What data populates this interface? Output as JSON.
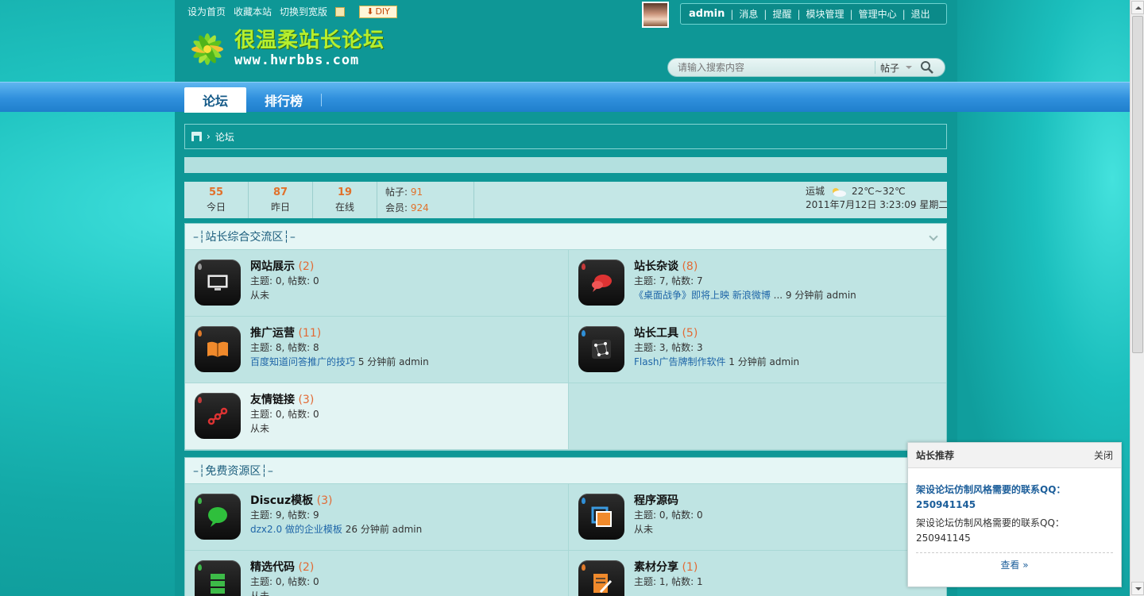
{
  "top_links": [
    "设为首页",
    "收藏本站",
    "切换到宽版"
  ],
  "diy_label": "DIY",
  "logo": {
    "title": "很温柔站长论坛",
    "url": "www.hwrbbs.com"
  },
  "user_bar": {
    "username": "admin",
    "items": [
      "消息",
      "提醒",
      "模块管理",
      "管理中心",
      "退出"
    ]
  },
  "search": {
    "placeholder": "请输入搜索内容",
    "type": "帖子"
  },
  "nav": {
    "tabs": [
      "论坛",
      "排行榜"
    ]
  },
  "breadcrumb": {
    "current": "论坛"
  },
  "stats": {
    "today": {
      "value": "55",
      "label": "今日"
    },
    "yesterday": {
      "value": "87",
      "label": "昨日"
    },
    "online": {
      "value": "19",
      "label": "在线"
    },
    "posts_label": "帖子: ",
    "posts": "91",
    "members_label": "会员: ",
    "members": "924",
    "weather_city": "运城",
    "weather_temp": "22℃~32℃",
    "datetime": "2011年7月12日 3:23:09 星期二"
  },
  "sections": [
    {
      "title": "–┆站长综合交流区┆–",
      "forums": [
        {
          "name": "网站展示",
          "count": "(2)",
          "meta": "主题: 0, 帖数: 0",
          "last": "从未",
          "last_link": "",
          "icon": "monitor-icon",
          "drop": "#9a9a9a"
        },
        {
          "name": "站长杂谈",
          "count": "(8)",
          "meta": "主题: 7, 帖数: 7",
          "last": " ... 9 分钟前 admin",
          "last_link": "《桌面战争》即将上映 新浪微博",
          "icon": "chat-bubble-icon",
          "drop": "#c53a3a"
        },
        {
          "name": "推广运营",
          "count": "(11)",
          "meta": "主题: 8, 帖数: 8",
          "last": " 5 分钟前 admin",
          "last_link": "百度知道问答推广的技巧",
          "icon": "book-icon",
          "drop": "#e07a2a"
        },
        {
          "name": "站长工具",
          "count": "(5)",
          "meta": "主题: 3, 帖数: 3",
          "last": " 1 分钟前 admin",
          "last_link": "Flash广告牌制作软件",
          "icon": "network-icon",
          "drop": "#2f8fd8"
        },
        {
          "name": "友情链接",
          "count": "(3)",
          "meta": "主题: 0, 帖数: 0",
          "last": "从未",
          "last_link": "",
          "icon": "link-icon",
          "drop": "#c53a3a"
        }
      ]
    },
    {
      "title": "–┆免费资源区┆–",
      "forums": [
        {
          "name": "Discuz模板",
          "count": "(3)",
          "meta": "主题: 9, 帖数: 9",
          "last": " 26 分钟前 admin",
          "last_link": "dzx2.0 做的企业模板",
          "icon": "speech-icon",
          "drop": "#3db84a"
        },
        {
          "name": "程序源码",
          "count": "",
          "meta": "主题: 0, 帖数: 0",
          "last": "从未",
          "last_link": "",
          "icon": "frame-icon",
          "drop": "#2f8fd8"
        },
        {
          "name": "精选代码",
          "count": "(2)",
          "meta": "主题: 0, 帖数: 0",
          "last": "从未",
          "last_link": "",
          "icon": "server-icon",
          "drop": "#3db84a"
        },
        {
          "name": "素材分享",
          "count": "(1)",
          "meta": "主题: 1, 帖数: 1",
          "last": "",
          "last_link": "",
          "icon": "edit-icon",
          "drop": "#e07a2a"
        }
      ]
    }
  ],
  "popup": {
    "title": "站长推荐",
    "close": "关闭",
    "headline": "架设论坛仿制风格需要的联系QQ：250941145",
    "text": "架设论坛仿制风格需要的联系QQ：250941145",
    "link": "查看 »"
  },
  "colors": {
    "teal": "#0e9796",
    "nav_blue": "#2f8fdc",
    "accent_orange": "#e1712b",
    "link_blue": "#1f66a8"
  }
}
